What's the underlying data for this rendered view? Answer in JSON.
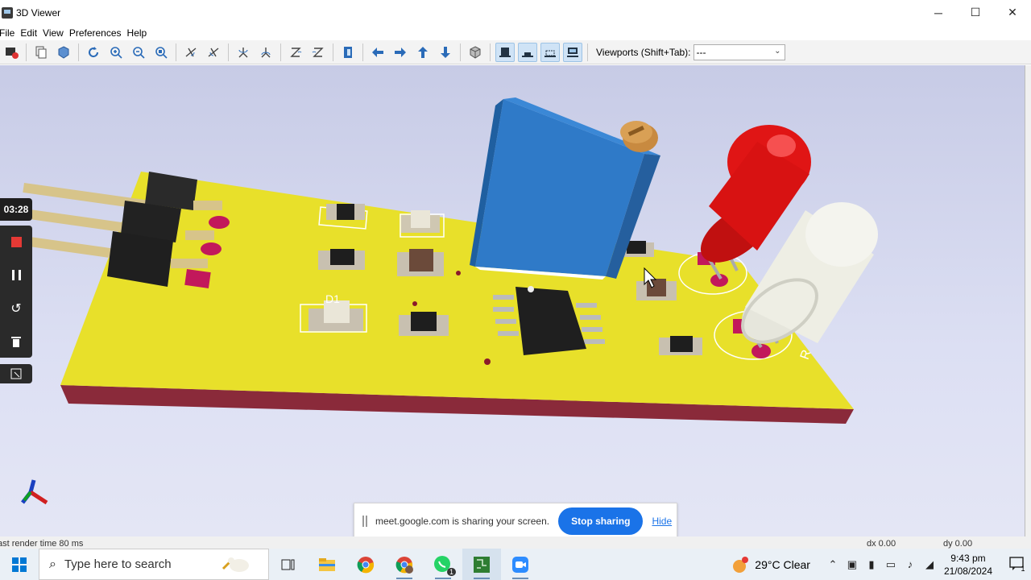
{
  "window": {
    "title": "3D Viewer"
  },
  "menu": [
    "File",
    "Edit",
    "View",
    "Preferences",
    "Help"
  ],
  "toolbar": {
    "viewports_label": "Viewports (Shift+Tab):",
    "viewports_value": "---"
  },
  "board": {
    "silkscreen": [
      "D1",
      "R"
    ],
    "board_color": "#e8e02a",
    "edge_color": "#8a2a3a",
    "trimpot_color": "#2f7ac8",
    "led_red": "#d01010",
    "led_white": "#f0f0e8"
  },
  "recording": {
    "time": "03:28"
  },
  "share_banner": {
    "message": "meet.google.com is sharing your screen.",
    "stop_label": "Stop sharing",
    "hide_label": "Hide"
  },
  "status": {
    "render_time": "ast render time 80 ms",
    "dx": "dx 0.00",
    "dy": "dy 0.00"
  },
  "taskbar": {
    "search_placeholder": "Type here to search",
    "weather": "29°C  Clear",
    "time": "9:43 pm",
    "date": "21/08/2024",
    "notification_count": "1",
    "whatsapp_badge": "1"
  }
}
